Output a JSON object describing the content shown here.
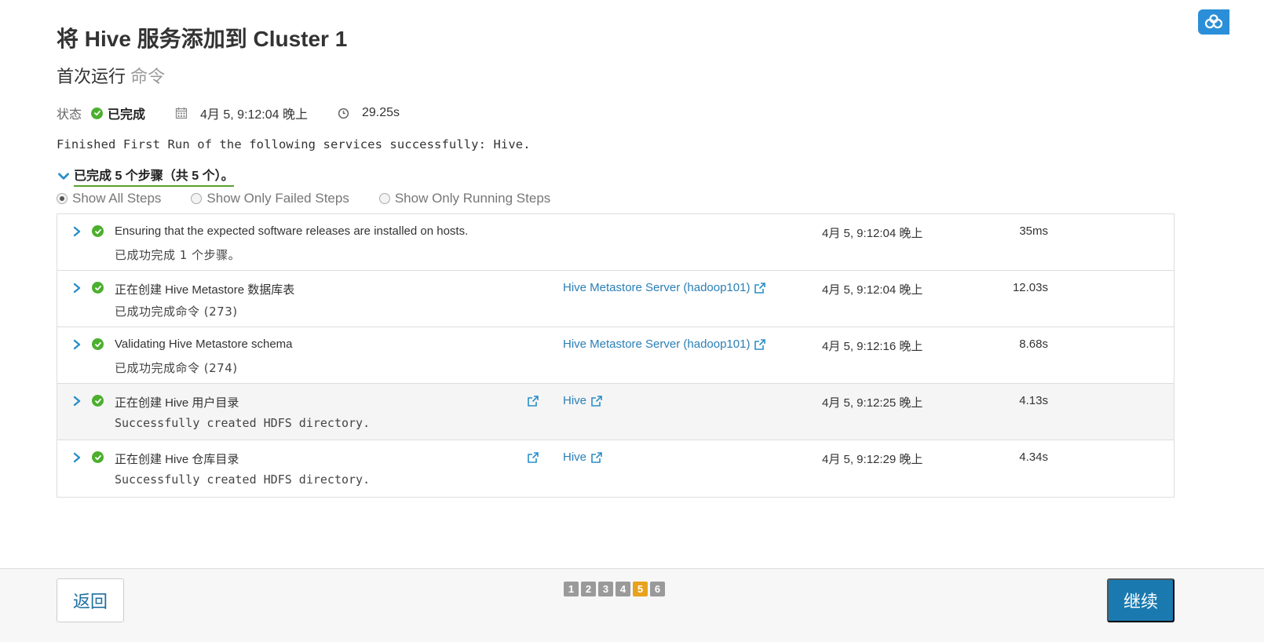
{
  "header": {
    "title": "将 Hive 服务添加到 Cluster 1",
    "subtitle_main": "首次运行",
    "subtitle_muted": "命令"
  },
  "status": {
    "label": "状态",
    "value": "已完成",
    "date": "4月 5, 9:12:04 晚上",
    "duration": "29.25s"
  },
  "message": "Finished First Run of the following services successfully: Hive.",
  "steps_summary": "已完成 5 个步骤（共 5 个）。",
  "filters": [
    {
      "label": "Show All Steps",
      "selected": true
    },
    {
      "label": "Show Only Failed Steps",
      "selected": false
    },
    {
      "label": "Show Only Running Steps",
      "selected": false
    }
  ],
  "steps": [
    {
      "name": "Ensuring that the expected software releases are installed on hosts.",
      "detail": "已成功完成 1 个步骤。",
      "host": "",
      "time": "4月 5, 9:12:04 晚上",
      "duration": "35ms"
    },
    {
      "name": "正在创建 Hive Metastore 数据库表",
      "detail": "已成功完成命令 (273)",
      "host": "Hive Metastore Server (hadoop101)",
      "time": "4月 5, 9:12:04 晚上",
      "duration": "12.03s"
    },
    {
      "name": "Validating Hive Metastore schema",
      "detail": "已成功完成命令 (274)",
      "host": "Hive Metastore Server (hadoop101)",
      "time": "4月 5, 9:12:16 晚上",
      "duration": "8.68s"
    },
    {
      "name": "正在创建 Hive 用户目录",
      "detail": "Successfully created HDFS directory.",
      "host": "Hive",
      "time": "4月 5, 9:12:25 晚上",
      "duration": "4.13s"
    },
    {
      "name": "正在创建 Hive 仓库目录",
      "detail": "Successfully created HDFS directory.",
      "host": "Hive",
      "time": "4月 5, 9:12:29 晚上",
      "duration": "4.34s"
    }
  ],
  "footer": {
    "back_label": "返回",
    "continue_label": "继续",
    "pages": [
      "1",
      "2",
      "3",
      "4",
      "5",
      "6"
    ],
    "current_page": "5"
  },
  "colors": {
    "accent": "#1a7ab0",
    "success": "#4caf2e",
    "link": "#2a7fb5",
    "active_page": "#e8a21d"
  }
}
